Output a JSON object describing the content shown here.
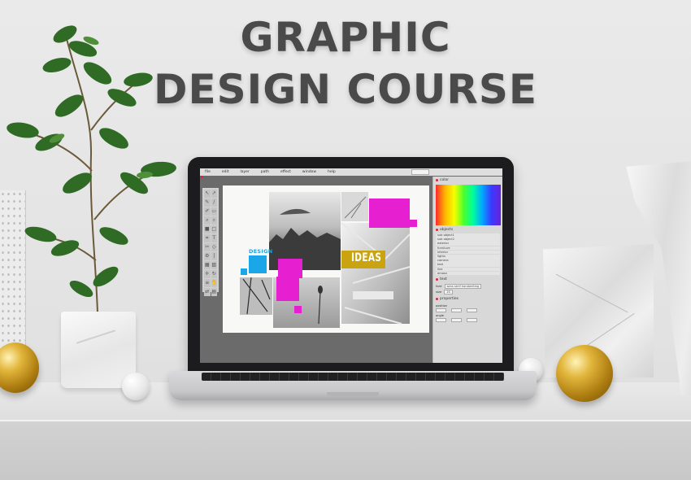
{
  "headline": {
    "line1": "GRAPHIC",
    "line2": "DESIGN COURSE"
  },
  "app": {
    "menu": [
      "file",
      "edit",
      "layer",
      "path",
      "effect",
      "window",
      "help"
    ],
    "panels": {
      "color_title": "color",
      "objects_title": "objects",
      "objects": [
        "sub object1",
        "sub object2",
        "exterior",
        "furniture",
        "interior",
        "lights",
        "camera",
        "text",
        "line",
        "amosn"
      ],
      "text_title": "text",
      "font_label": "font",
      "font_value": "sans serif handwriting",
      "size_label": "size",
      "size_value": "20",
      "properties_title": "properties",
      "position_label": "position",
      "angle_label": "angle"
    },
    "canvas": {
      "design_label": "DESIGN",
      "ideas_label": "IDEAS"
    }
  },
  "colors": {
    "headline": "#4a4a4a",
    "magenta": "#e61fd0",
    "cyan": "#1aa6e8",
    "yellow": "#c9a410",
    "gold": "#d4a628"
  },
  "icons": [
    "plant-icon",
    "gold-sphere-icon",
    "pearl-icon",
    "marble-block-icon"
  ]
}
